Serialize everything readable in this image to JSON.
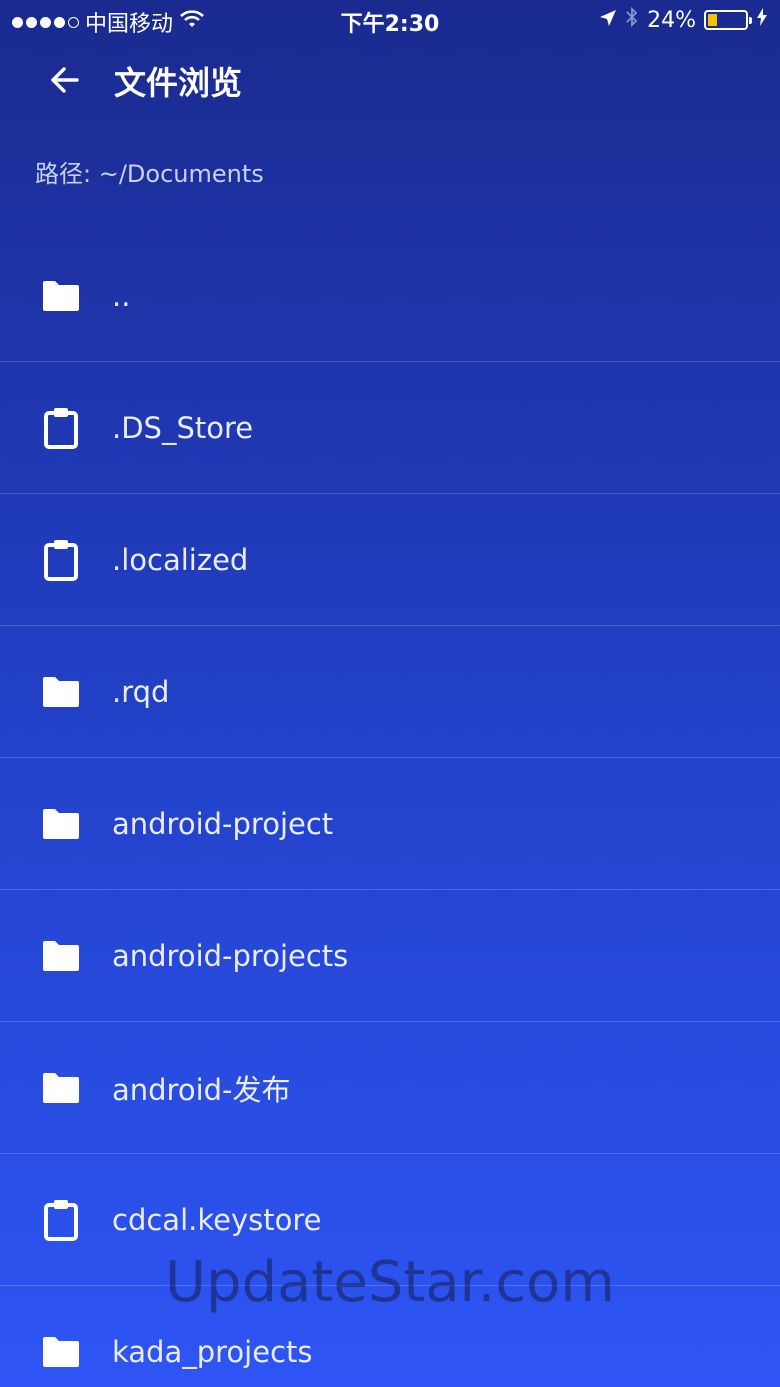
{
  "status_bar": {
    "carrier": "中国移动",
    "time": "下午2:30",
    "battery_percent": "24%",
    "battery_level": 0.24,
    "signal_bars": 4
  },
  "app_bar": {
    "back_icon": "arrow-left-icon",
    "title": "文件浏览"
  },
  "path": {
    "label": "路径: ~/Documents"
  },
  "files": [
    {
      "name": "..",
      "type": "folder",
      "icon": "folder-icon"
    },
    {
      "name": ".DS_Store",
      "type": "file",
      "icon": "clipboard-icon"
    },
    {
      "name": ".localized",
      "type": "file",
      "icon": "clipboard-icon"
    },
    {
      "name": ".rqd",
      "type": "folder",
      "icon": "folder-icon"
    },
    {
      "name": "android-project",
      "type": "folder",
      "icon": "folder-icon"
    },
    {
      "name": "android-projects",
      "type": "folder",
      "icon": "folder-icon"
    },
    {
      "name": "android-发布",
      "type": "folder",
      "icon": "folder-icon"
    },
    {
      "name": "cdcal.keystore",
      "type": "file",
      "icon": "clipboard-icon"
    },
    {
      "name": "kada_projects",
      "type": "folder",
      "icon": "folder-icon"
    }
  ],
  "watermark": "UpdateStar.com",
  "colors": {
    "gradient_top": "#1a2a8f",
    "gradient_bottom": "#2e55f5",
    "battery_fill": "#f5c400"
  }
}
